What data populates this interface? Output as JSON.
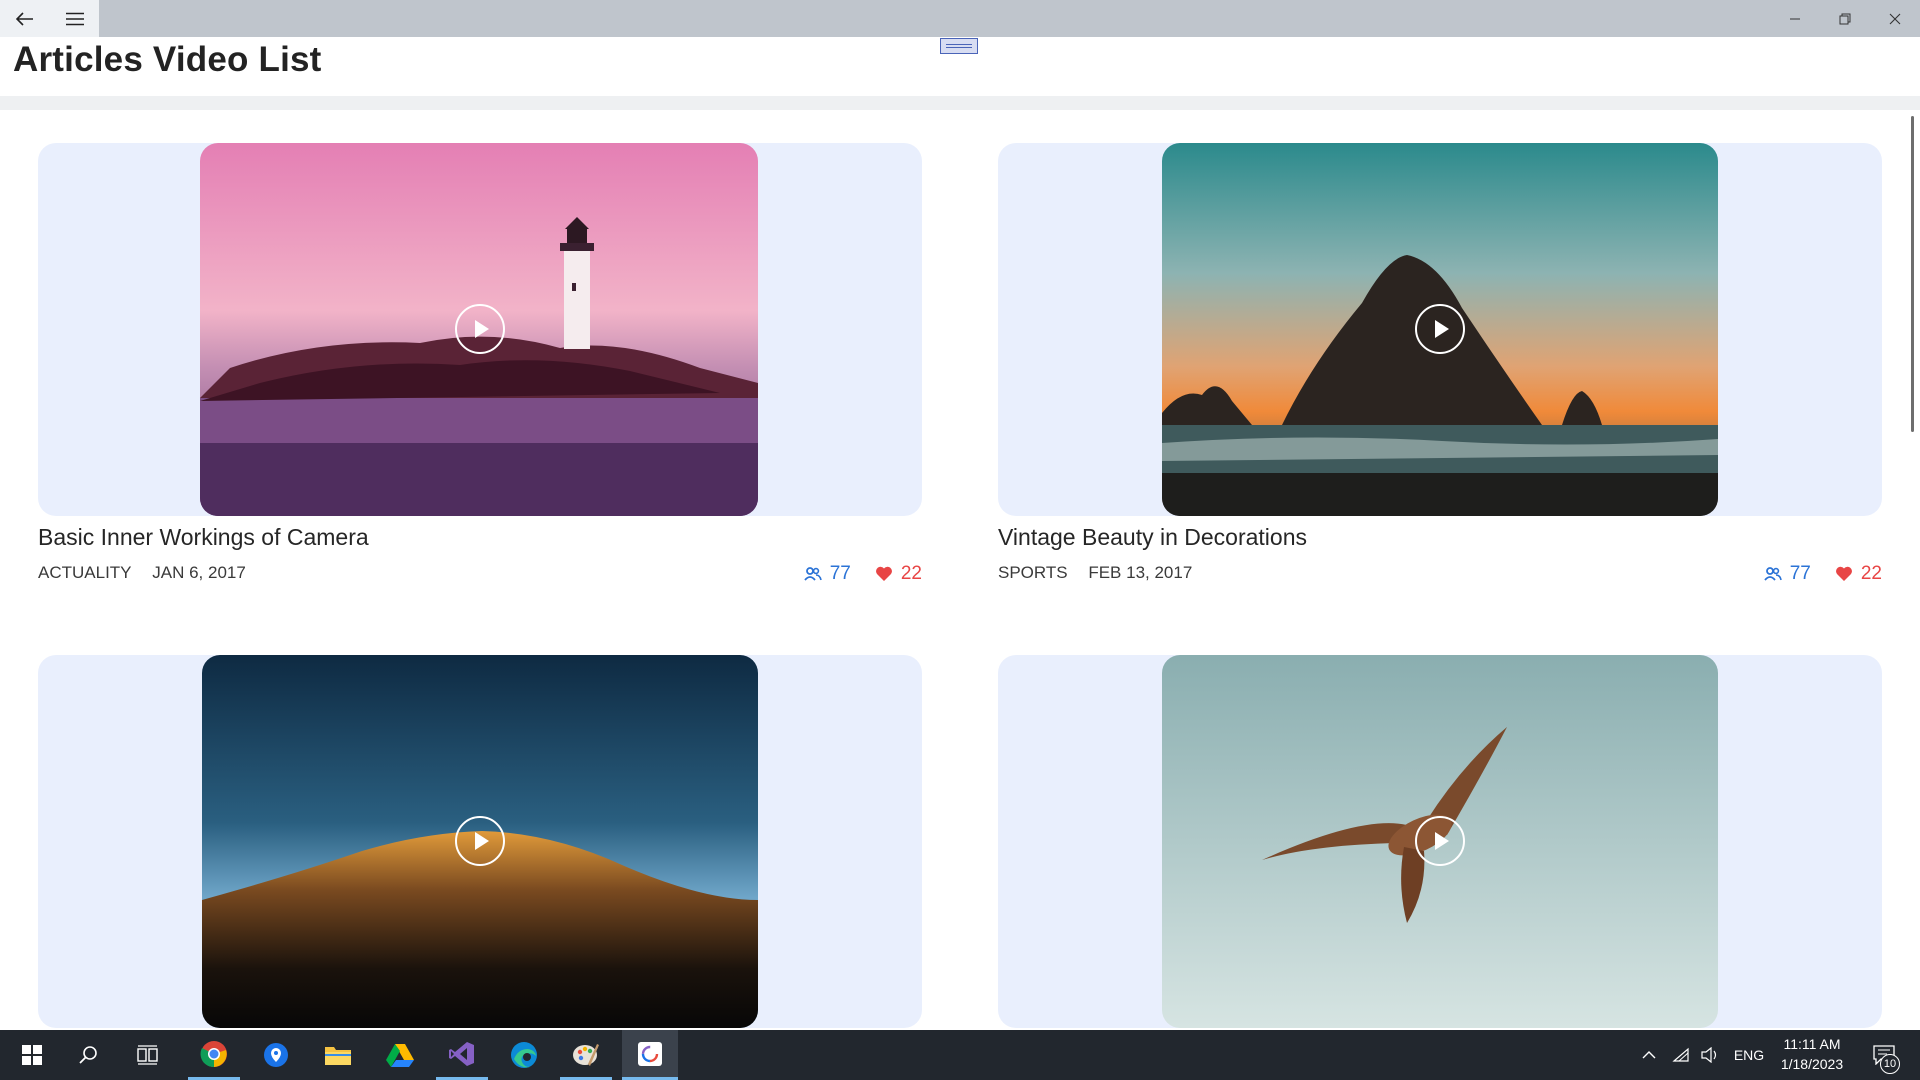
{
  "window": {
    "back_icon": "back-arrow-icon",
    "menu_icon": "hamburger-menu-icon",
    "controls": [
      "minimize-icon",
      "maximize-icon",
      "close-icon"
    ]
  },
  "page": {
    "title": "Articles Video List"
  },
  "articles": [
    {
      "title": "Basic Inner Workings of Camera",
      "category": "ACTUALITY",
      "date": "JAN 6, 2017",
      "views": "77",
      "likes": "22",
      "image": "lighthouse-at-pink-dusk"
    },
    {
      "title": "Vintage Beauty in Decorations",
      "category": "SPORTS",
      "date": "FEB 13, 2017",
      "views": "77",
      "likes": "22",
      "image": "sea-rock-at-sunset"
    },
    {
      "title": "",
      "category": "",
      "date": "",
      "views": "",
      "likes": "",
      "image": "desert-dune-at-night"
    },
    {
      "title": "",
      "category": "",
      "date": "",
      "views": "",
      "likes": "",
      "image": "flying-kite-bird"
    }
  ],
  "taskbar": {
    "apps": [
      "windows-start-icon",
      "search-icon",
      "task-view-icon",
      "chrome-icon",
      "maps-icon",
      "file-explorer-icon",
      "google-drive-icon",
      "visual-studio-icon",
      "edge-icon",
      "paint-icon",
      "app-current-icon"
    ],
    "language": "ENG",
    "time": "11:11 AM",
    "date": "1/18/2023",
    "notifications": "10"
  },
  "colors": {
    "accent_blue": "#2b73d6",
    "like_red": "#e84545",
    "card_bg": "#e9effd",
    "taskbar_bg": "#22272e"
  }
}
